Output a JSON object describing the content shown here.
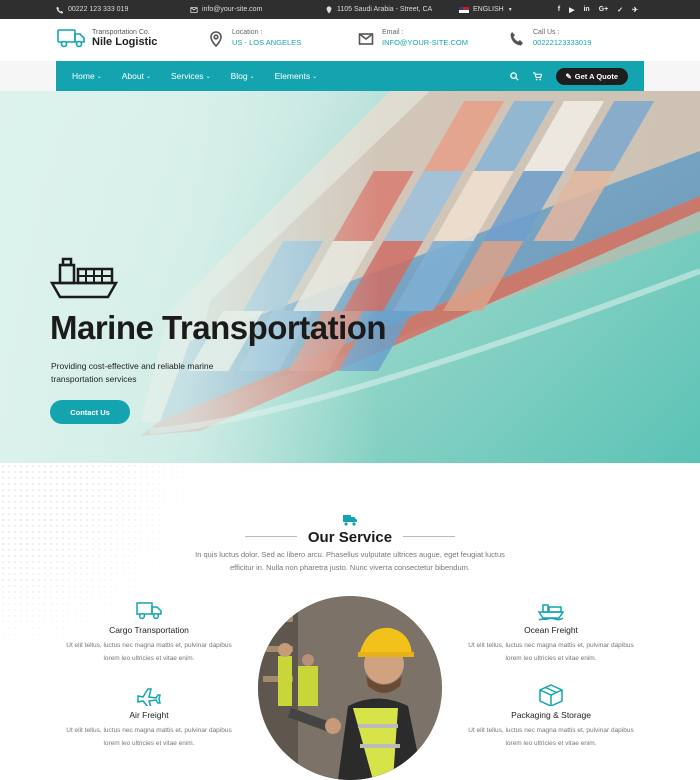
{
  "topbar": {
    "phone": "00222 123 333 019",
    "email": "info@your-site.com",
    "address": "1105 Saudi Arabia - Street, CA",
    "language": "ENGLISH",
    "social": [
      "f",
      "▶",
      "in",
      "G+",
      "🐦",
      "tw"
    ]
  },
  "header": {
    "logo_sub": "Transportation Co.",
    "logo_main": "Nile Logistic",
    "location_label": "Location :",
    "location_value": "US - LOS ANGELES",
    "email_label": "Email :",
    "email_value": "INFO@YOUR-SITE.COM",
    "call_label": "Call Us :",
    "call_value": "00222123333019"
  },
  "nav": {
    "items": [
      "Home",
      "About",
      "Services",
      "Blog",
      "Elements"
    ],
    "quote_label": "Get A Quote"
  },
  "hero": {
    "title": "Marine Transportation",
    "text": "Providing cost-effective and reliable marine transportation services",
    "button": "Contact Us"
  },
  "service": {
    "title": "Our Service",
    "desc": "In quis luctus dolor. Sed ac libero arcu. Phasellus vulputate ultrices augue, eget feugiat luctus efficitur in. Nulla non pharetra justo. Nunc viverra consectetur bibendum.",
    "cards": [
      {
        "title": "Cargo Transportation",
        "desc": "Ut elit tellus, luctus nec magna mattis et, pulvinar dapibus lorem leo ultricies et vitae enim."
      },
      {
        "title": "Ocean Freight",
        "desc": "Ut elit tellus, luctus nec magna mattis et, pulvinar dapibus lorem leo ultricies et vitae enim."
      },
      {
        "title": "Air Freight",
        "desc": "Ut elit tellus, luctus nec magna mattis et, pulvinar dapibus lorem leo ultricies et vitae enim."
      },
      {
        "title": "Packaging & Storage",
        "desc": "Ut elit tellus, luctus nec magna mattis et, pulvinar dapibus lorem leo ultricies et vitae enim."
      }
    ]
  },
  "colors": {
    "accent": "#13a4af",
    "dark": "#2f2f2f"
  }
}
